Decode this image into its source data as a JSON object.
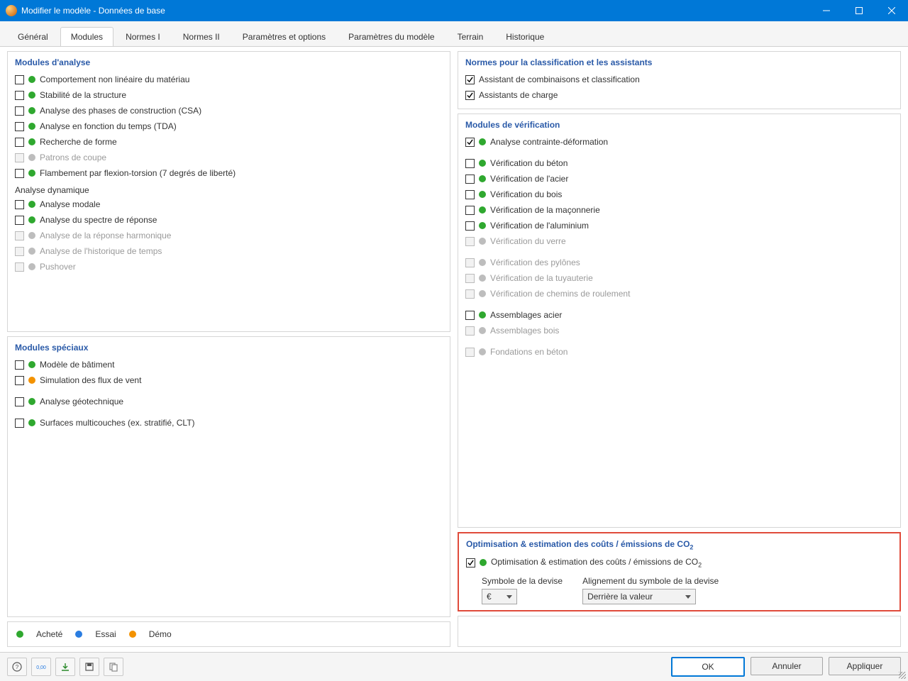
{
  "window": {
    "title": "Modifier le modèle - Données de base"
  },
  "tabs": {
    "general": "Général",
    "modules": "Modules",
    "normes1": "Normes I",
    "normes2": "Normes II",
    "params": "Paramètres et options",
    "model_params": "Paramètres du modèle",
    "terrain": "Terrain",
    "history": "Historique"
  },
  "panels": {
    "analysis": {
      "title": "Modules d'analyse",
      "dyn_sub": "Analyse dynamique"
    },
    "special": {
      "title": "Modules spéciaux"
    },
    "norms": {
      "title": "Normes pour la classification et les assistants"
    },
    "verif": {
      "title": "Modules de vérification"
    },
    "opti": {
      "title_prefix": "Optimisation & estimation des coûts / émissions de CO",
      "title_sub": "2",
      "row_prefix": "Optimisation & estimation des coûts / émissions de CO",
      "row_sub": "2",
      "currency_label": "Symbole de la devise",
      "alignment_label": "Alignement du symbole de la devise",
      "currency_value": "€",
      "alignment_value": "Derrière la valeur"
    }
  },
  "analysis_items": {
    "nonlinear": "Comportement non linéaire du matériau",
    "stability": "Stabilité de la structure",
    "csa": "Analyse des phases de construction (CSA)",
    "tda": "Analyse en fonction du temps (TDA)",
    "formfind": "Recherche de forme",
    "cutpatterns": "Patrons de coupe",
    "tfb": "Flambement par flexion-torsion (7 degrés de liberté)",
    "modal": "Analyse modale",
    "response": "Analyse du spectre de réponse",
    "harmonic": "Analyse de la réponse harmonique",
    "timehist": "Analyse de l'historique de temps",
    "pushover": "Pushover"
  },
  "special_items": {
    "building": "Modèle de bâtiment",
    "wind": "Simulation des flux de vent",
    "geo": "Analyse géotechnique",
    "multilayer": "Surfaces multicouches (ex. stratifié, CLT)"
  },
  "norms_items": {
    "combo": "Assistant de combinaisons et classification",
    "load": "Assistants de charge"
  },
  "verif_items": {
    "stressstrain": "Analyse contrainte-déformation",
    "concrete": "Vérification du béton",
    "steel": "Vérification de l'acier",
    "timber": "Vérification du bois",
    "masonry": "Vérification de la maçonnerie",
    "aluminum": "Vérification de l'aluminium",
    "glass": "Vérification du verre",
    "towers": "Vérification des pylônes",
    "piping": "Vérification de la tuyauterie",
    "crane": "Vérification de chemins de roulement",
    "steeljoints": "Assemblages acier",
    "timberjoints": "Assemblages bois",
    "foundations": "Fondations en béton"
  },
  "legend": {
    "bought": "Acheté",
    "trial": "Essai",
    "demo": "Démo"
  },
  "buttons": {
    "ok": "OK",
    "cancel": "Annuler",
    "apply": "Appliquer"
  }
}
